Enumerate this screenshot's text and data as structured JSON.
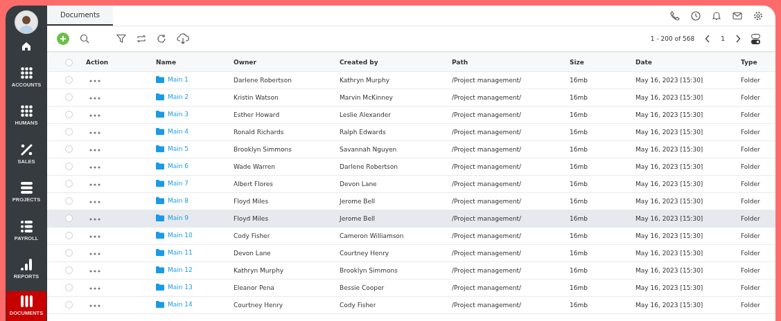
{
  "sidebar": {
    "items": [
      {
        "kind": "home",
        "selected": false
      },
      {
        "kind": "accounts",
        "label": "ACCOUNTS",
        "selected": false
      },
      {
        "kind": "humans",
        "label": "HUMANS",
        "selected": false
      },
      {
        "kind": "sales",
        "label": "SALES",
        "selected": false
      },
      {
        "kind": "projects",
        "label": "PROJECTS",
        "selected": false
      },
      {
        "kind": "payroll",
        "label": "PAYROLL",
        "selected": false
      },
      {
        "kind": "reports",
        "label": "REPORTS",
        "selected": false
      },
      {
        "kind": "documents",
        "label": "DOCUMENTS",
        "selected": true
      }
    ]
  },
  "tabs": [
    {
      "label": "Documents",
      "selected": true
    }
  ],
  "pagination": {
    "range": "1 - 200 of 568",
    "page": "1"
  },
  "table": {
    "all_checked": false,
    "columns": [
      "Action",
      "Name",
      "Owner",
      "Created by",
      "Path",
      "Size",
      "Date",
      "Type"
    ],
    "rows": [
      {
        "name": "Main 1",
        "owner": "Darlene Robertson",
        "created_by": "Kathryn Murphy",
        "path": "/Project management/",
        "size": "16mb",
        "date": "May 16, 2023 [15:30]",
        "type": "Folder",
        "selected": false
      },
      {
        "name": "Main 2",
        "owner": "Kristin Watson",
        "created_by": "Marvin McKinney",
        "path": "/Project management/",
        "size": "16mb",
        "date": "May 16, 2023 [15:30]",
        "type": "Folder",
        "selected": false
      },
      {
        "name": "Main 3",
        "owner": "Esther Howard",
        "created_by": "Leslie Alexander",
        "path": "/Project management/",
        "size": "16mb",
        "date": "May 16, 2023 [15:30]",
        "type": "Folder",
        "selected": false
      },
      {
        "name": "Main 4",
        "owner": "Ronald Richards",
        "created_by": "Ralph Edwards",
        "path": "/Project management/",
        "size": "16mb",
        "date": "May 16, 2023 [15:30]",
        "type": "Folder",
        "selected": false
      },
      {
        "name": "Main 5",
        "owner": "Brooklyn Simmons",
        "created_by": "Savannah Nguyen",
        "path": "/Project management/",
        "size": "16mb",
        "date": "May 16, 2023 [15:30]",
        "type": "Folder",
        "selected": false
      },
      {
        "name": "Main 6",
        "owner": "Wade Warren",
        "created_by": "Darlene Robertson",
        "path": "/Project management/",
        "size": "16mb",
        "date": "May 16, 2023 [15:30]",
        "type": "Folder",
        "selected": false
      },
      {
        "name": "Main 7",
        "owner": "Albert Flores",
        "created_by": "Devon Lane",
        "path": "/Project management/",
        "size": "16mb",
        "date": "May 16, 2023 [15:30]",
        "type": "Folder",
        "selected": false
      },
      {
        "name": "Main 8",
        "owner": "Floyd Miles",
        "created_by": "Jerome Bell",
        "path": "/Project management/",
        "size": "16mb",
        "date": "May 16, 2023 [15:30]",
        "type": "Folder",
        "selected": false
      },
      {
        "name": "Main 9",
        "owner": "Floyd Miles",
        "created_by": "Jerome Bell",
        "path": "/Project management/",
        "size": "16mb",
        "date": "May 16, 2023 [15:30]",
        "type": "Folder",
        "selected": true
      },
      {
        "name": "Main 10",
        "owner": "Cody Fisher",
        "created_by": "Cameron Williamson",
        "path": "/Project management/",
        "size": "16mb",
        "date": "May 16, 2023 [15:30]",
        "type": "Folder",
        "selected": false
      },
      {
        "name": "Main 11",
        "owner": "Devon Lane",
        "created_by": "Courtney Henry",
        "path": "/Project management/",
        "size": "16mb",
        "date": "May 16, 2023 [15:30]",
        "type": "Folder",
        "selected": false
      },
      {
        "name": "Main 12",
        "owner": "Kathryn Murphy",
        "created_by": "Brooklyn Simmons",
        "path": "/Project management/",
        "size": "16mb",
        "date": "May 16, 2023 [15:30]",
        "type": "Folder",
        "selected": false
      },
      {
        "name": "Main 13",
        "owner": "Eleanor Pena",
        "created_by": "Bessie Cooper",
        "path": "/Project management/",
        "size": "16mb",
        "date": "May 16, 2023 [15:30]",
        "type": "Folder",
        "selected": false
      },
      {
        "name": "Main 14",
        "owner": "Courtney Henry",
        "created_by": "Cody Fisher",
        "path": "/Project management/",
        "size": "16mb",
        "date": "May 16, 2023 [15:30]",
        "type": "Folder",
        "selected": false
      }
    ]
  }
}
